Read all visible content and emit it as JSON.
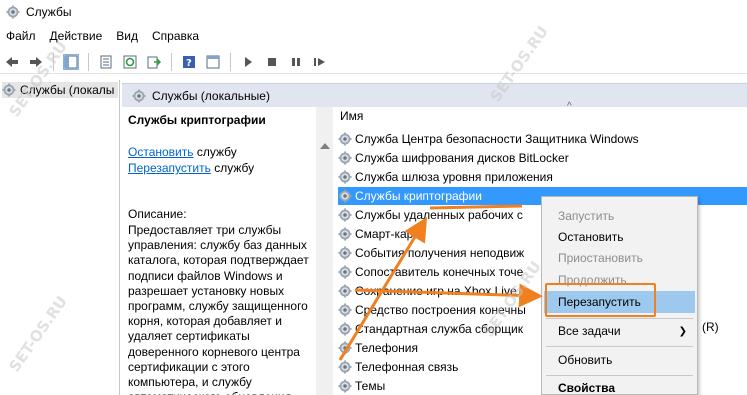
{
  "window": {
    "title": "Службы"
  },
  "menu": {
    "items": [
      "Файл",
      "Действие",
      "Вид",
      "Справка"
    ]
  },
  "tree": {
    "item": "Службы (локалы"
  },
  "panel": {
    "header": "Службы (локальные)"
  },
  "description": {
    "service_title": "Службы криптографии",
    "stop_link": "Остановить",
    "stop_suffix": " службу",
    "restart_link": "Перезапустить",
    "restart_suffix": " службу",
    "label": "Описание:",
    "text": "Предоставляет три службы управления: службу баз данных каталога, которая подтверждает подписи файлов Windows и разрешает установку новых программ, службу защищенного корня, которая добавляет и удаляет сертификаты доверенного корневого центра сертификации с этого компьютера, и службу автоматического обновления"
  },
  "list": {
    "column": "Имя",
    "rows": [
      "Служба Центра безопасности Защитника Windows",
      "Служба шифрования дисков BitLocker",
      "Служба шлюза уровня приложения",
      "Службы криптографии",
      "Службы удаленных рабочих с",
      "Смарт-карта",
      "События получения неподвиж",
      "Сопоставитель конечных точе",
      "Сохранение игр на Xbox Live",
      "Средство построения конечны",
      "Стандартная служба сборщик",
      "Телефония",
      "Телефонная связь",
      "Темы"
    ]
  },
  "context_menu": {
    "start": "Запустить",
    "stop": "Остановить",
    "pause": "Приостановить",
    "resume": "Продолжить",
    "restart": "Перезапустить",
    "all_tasks": "Все задачи",
    "refresh": "Обновить",
    "properties": "Свойства"
  },
  "suffix_text": "(R)",
  "watermark": "SET-OS.RU",
  "colors": {
    "selection": "#3399ff",
    "highlight": "#9ec9ef",
    "accent_orange": "#f08020",
    "link": "#0066cc"
  }
}
